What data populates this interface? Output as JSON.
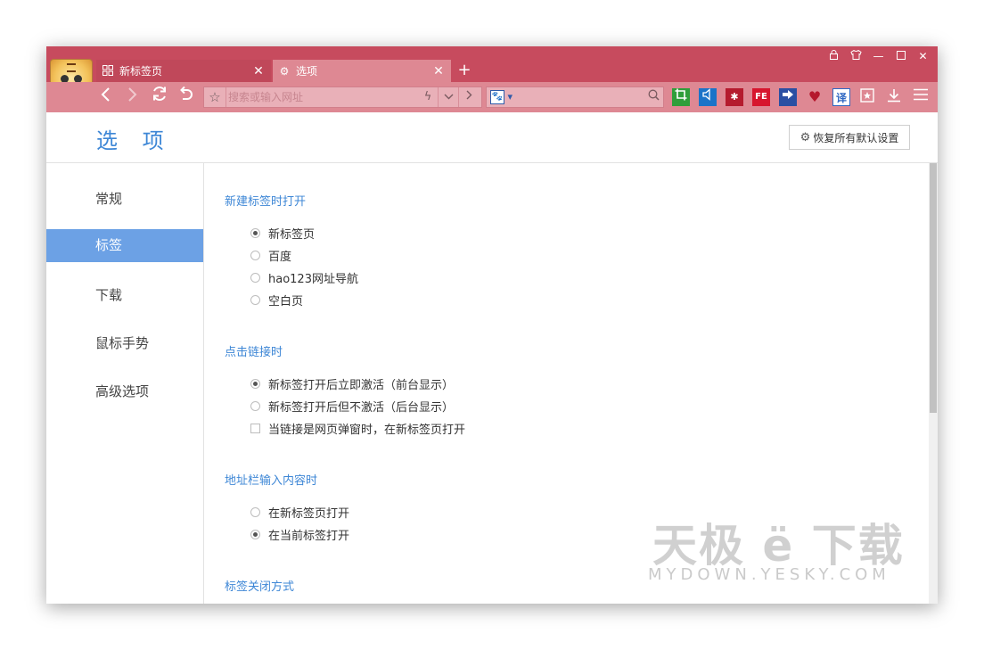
{
  "tabs": [
    {
      "label": "新标签页",
      "icon": "grid-icon"
    },
    {
      "label": "选项",
      "icon": "gear-icon"
    }
  ],
  "address_bar": {
    "placeholder": "搜索或输入网址"
  },
  "page": {
    "title": "选 项",
    "reset_label": "恢复所有默认设置"
  },
  "sidebar": {
    "items": [
      "常规",
      "标签",
      "下载",
      "鼠标手势",
      "高级选项"
    ],
    "active_index": 1
  },
  "sections": [
    {
      "title": "新建标签时打开",
      "options": [
        {
          "label": "新标签页",
          "type": "radio",
          "checked": true
        },
        {
          "label": "百度",
          "type": "radio",
          "checked": false
        },
        {
          "label": "hao123网址导航",
          "type": "radio",
          "checked": false
        },
        {
          "label": "空白页",
          "type": "radio",
          "checked": false
        }
      ]
    },
    {
      "title": "点击链接时",
      "options": [
        {
          "label": "新标签打开后立即激活（前台显示）",
          "type": "radio",
          "checked": true
        },
        {
          "label": "新标签打开后但不激活（后台显示）",
          "type": "radio",
          "checked": false
        },
        {
          "label": "当链接是网页弹窗时，在新标签页打开",
          "type": "checkbox",
          "checked": false
        }
      ]
    },
    {
      "title": "地址栏输入内容时",
      "options": [
        {
          "label": "在新标签页打开",
          "type": "radio",
          "checked": false
        },
        {
          "label": "在当前标签打开",
          "type": "radio",
          "checked": true
        }
      ]
    },
    {
      "title": "标签关闭方式",
      "options": []
    }
  ],
  "extensions": {
    "fe_label": "FE",
    "translate_label": "译"
  },
  "watermark": {
    "line1": "天极 ë 下载",
    "line2": "MYDOWN.YESKY.COM"
  },
  "colors": {
    "titlebar": "#c74b5e",
    "toolbar": "#de8893",
    "accent": "#3e87d6",
    "active_sidebar": "#6ca1e5"
  }
}
